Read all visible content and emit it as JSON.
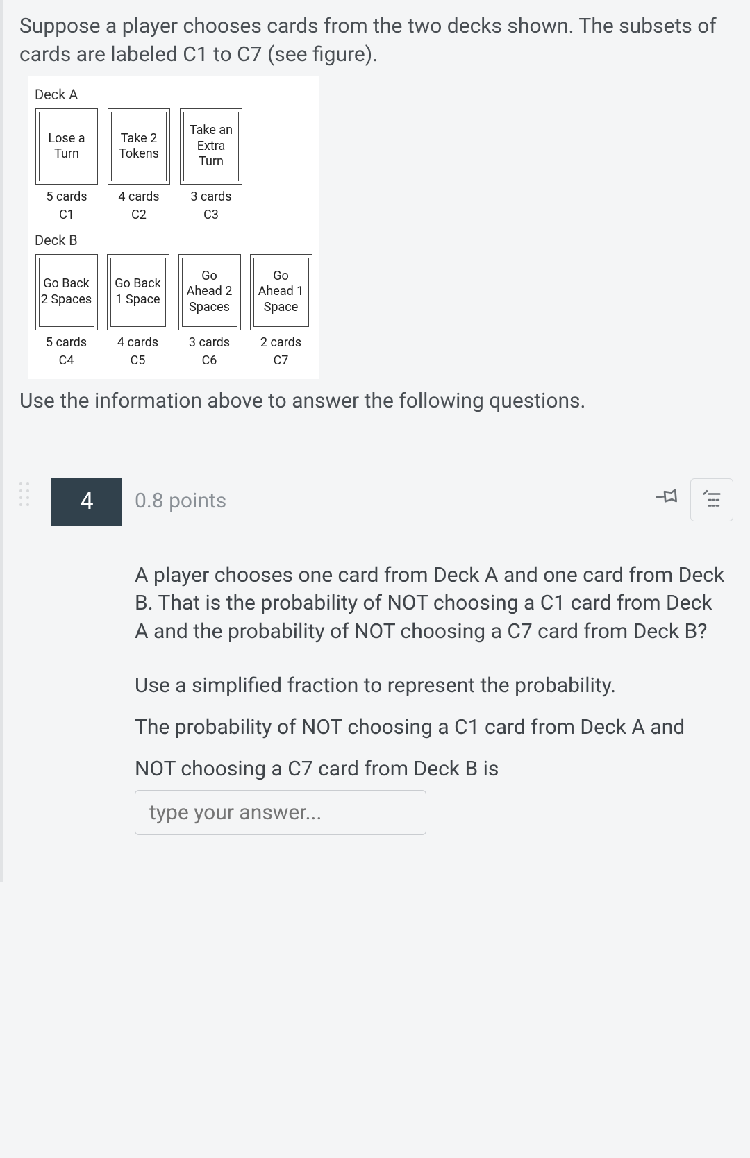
{
  "intro": "Suppose a player chooses cards from the two decks shown. The subsets of cards are labeled C1 to C7 (see figure).",
  "figure": {
    "deckA": {
      "label": "Deck A",
      "cards": [
        {
          "text": "Lose a Turn",
          "count": "5 cards",
          "code": "C1"
        },
        {
          "text": "Take 2 Tokens",
          "count": "4 cards",
          "code": "C2"
        },
        {
          "text": "Take an Extra Turn",
          "count": "3 cards",
          "code": "C3"
        }
      ]
    },
    "deckB": {
      "label": "Deck B",
      "cards": [
        {
          "text": "Go Back 2 Spaces",
          "count": "5 cards",
          "code": "C4"
        },
        {
          "text": "Go Back 1 Space",
          "count": "4 cards",
          "code": "C5"
        },
        {
          "text": "Go Ahead 2 Spaces",
          "count": "3 cards",
          "code": "C6"
        },
        {
          "text": "Go Ahead 1 Space",
          "count": "2 cards",
          "code": "C7"
        }
      ]
    }
  },
  "followup": "Use the information above to answer the following questions.",
  "question": {
    "number": "4",
    "points": "0.8 points",
    "prompt": "A player chooses one card from Deck A and one card from Deck B. That is the probability of NOT choosing a C1 card from Deck A and the probability of NOT choosing a C7 card from Deck B?",
    "instruction": "Use a simplified fraction to represent the probability.",
    "answer_lead": "The probability of NOT choosing a C1 card from Deck A and NOT choosing a C7 card from Deck B is",
    "placeholder": "type your answer..."
  }
}
